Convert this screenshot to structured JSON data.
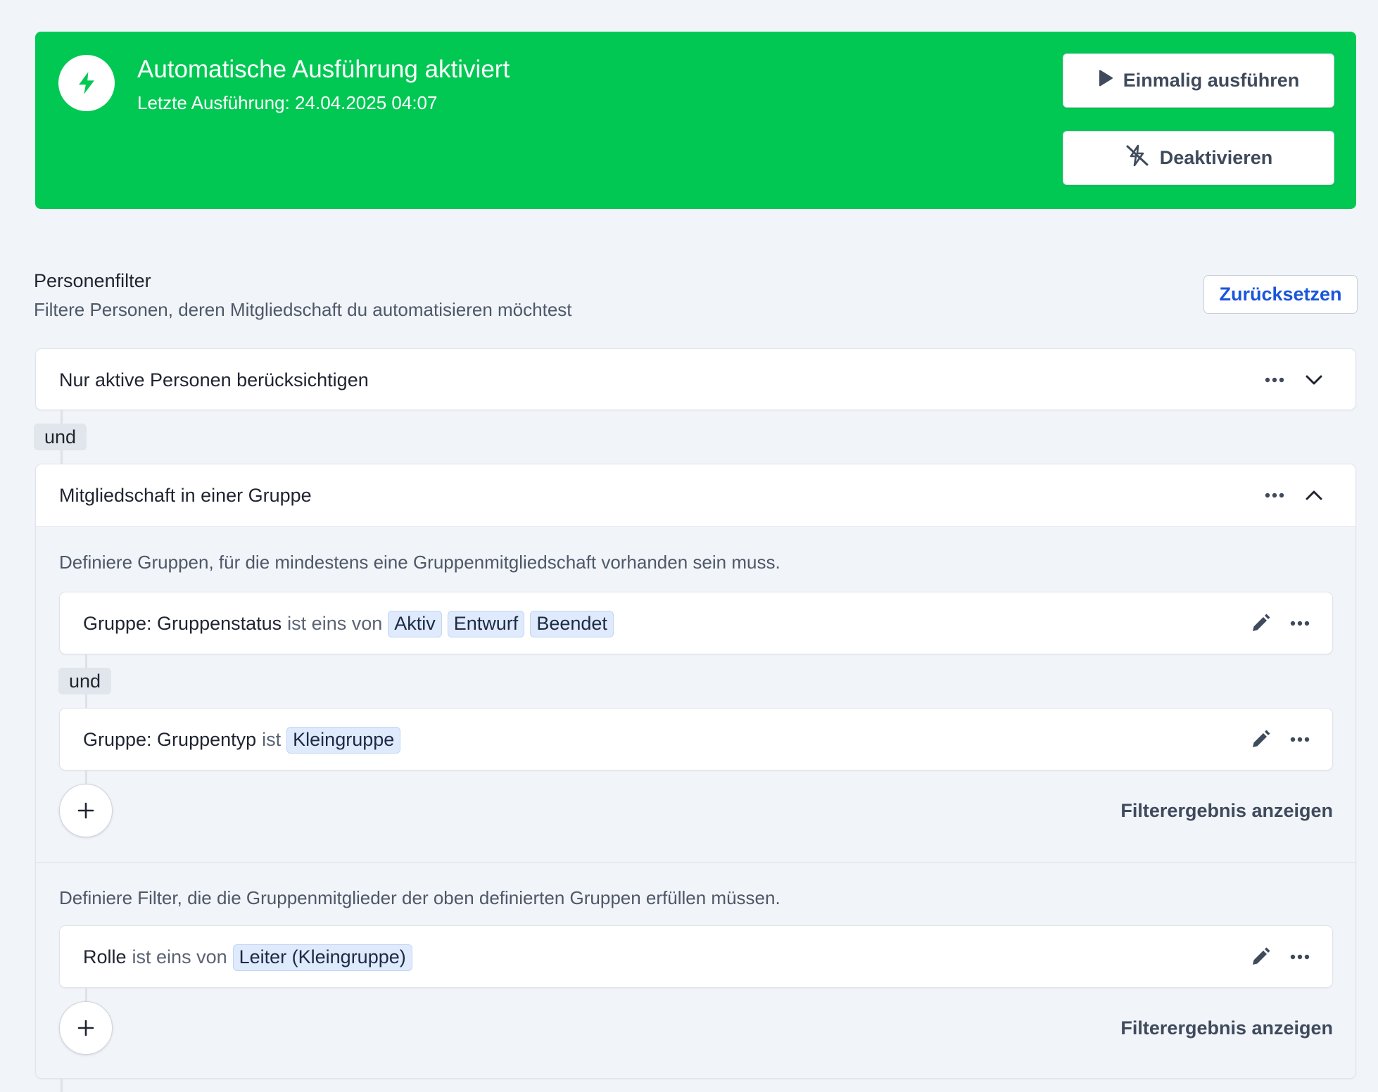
{
  "banner": {
    "title": "Automatische Ausführung aktiviert",
    "subtitle": "Letzte Ausführung: 24.04.2025 04:07",
    "icon": "lightning-icon",
    "color": "#00c853",
    "run_once_label": "Einmalig ausführen",
    "deactivate_label": "Deaktivieren"
  },
  "filter_section": {
    "title": "Personenfilter",
    "subtitle": "Filtere Personen, deren Mitgliedschaft du automatisieren möchtest",
    "reset_label": "Zurücksetzen"
  },
  "filters": {
    "active_persons": {
      "title": "Nur aktive Personen berücksichtigen"
    },
    "connector_1": "und",
    "group_membership": {
      "title": "Mitgliedschaft in einer Gruppe",
      "groups_hint": "Definiere Gruppen, für die mindestens eine Gruppenmitgliedschaft vorhanden sein muss.",
      "rule_1": {
        "field": "Gruppe: Gruppenstatus",
        "operator": "ist eins von",
        "values": [
          "Aktiv",
          "Entwurf",
          "Beendet"
        ]
      },
      "connector": "und",
      "rule_2": {
        "field": "Gruppe: Gruppentyp",
        "operator": "ist",
        "values": [
          "Kleingruppe"
        ]
      },
      "show_result_label": "Filterergebnis anzeigen",
      "members_hint": "Definiere Filter, die die Gruppenmitglieder der oben definierten Gruppen erfüllen müssen.",
      "rule_3": {
        "field": "Rolle",
        "operator": "ist eins von",
        "values": [
          "Leiter (Kleingruppe)"
        ]
      },
      "show_result_label_2": "Filterergebnis anzeigen"
    }
  }
}
